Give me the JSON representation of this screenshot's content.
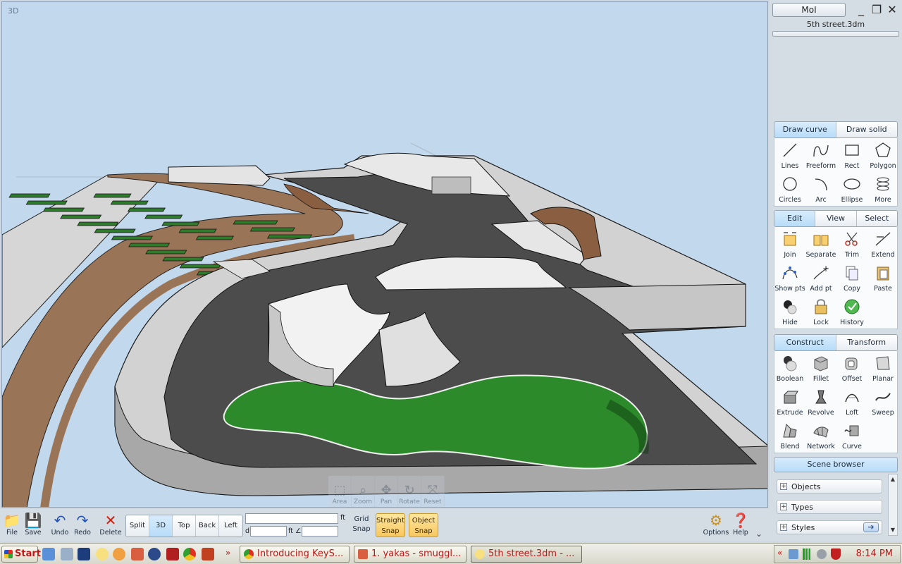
{
  "viewport": {
    "label": "3D",
    "nav_tools": [
      {
        "label": "Area",
        "icon": "area-zoom-icon"
      },
      {
        "label": "Zoom",
        "icon": "zoom-icon"
      },
      {
        "label": "Pan",
        "icon": "pan-icon"
      },
      {
        "label": "Rotate",
        "icon": "rotate-icon"
      },
      {
        "label": "Reset",
        "icon": "reset-icon"
      }
    ]
  },
  "header": {
    "app_button": "MoI",
    "file_name": "5th street.3dm"
  },
  "draw_tabs": [
    "Draw curve",
    "Draw solid"
  ],
  "draw_tools": [
    "Lines",
    "Freeform",
    "Rect",
    "Polygon",
    "Circles",
    "Arc",
    "Ellipse",
    "More"
  ],
  "edit_tabs": [
    "Edit",
    "View",
    "Select"
  ],
  "edit_tools": [
    "Join",
    "Separate",
    "Trim",
    "Extend",
    "Show pts",
    "Add pt",
    "Copy",
    "Paste",
    "Hide",
    "Lock",
    "History"
  ],
  "construct_tabs": [
    "Construct",
    "Transform"
  ],
  "construct_tools": [
    "Boolean",
    "Fillet",
    "Offset",
    "Planar",
    "Extrude",
    "Revolve",
    "Loft",
    "Sweep",
    "Blend",
    "Network",
    "Curve"
  ],
  "scene_browser": {
    "title": "Scene browser",
    "items": [
      "Objects",
      "Types",
      "Styles"
    ]
  },
  "bottom": {
    "file": "File",
    "save": "Save",
    "undo": "Undo",
    "redo": "Redo",
    "delete": "Delete",
    "view_tabs": [
      "Split",
      "3D",
      "Top",
      "Back",
      "Left"
    ],
    "unit": "ft",
    "d_label": "d",
    "angle_label": "∠",
    "grid_snap": [
      "Grid",
      "Snap"
    ],
    "straight_snap": [
      "Straight",
      "Snap"
    ],
    "object_snap": [
      "Object",
      "Snap"
    ],
    "options": "Options",
    "help": "Help"
  },
  "taskbar": {
    "start": "Start",
    "tasks": [
      "Introducing KeyS...",
      "1. yakas - smuggl...",
      "5th street.3dm - ..."
    ],
    "clock": "8:14 PM"
  }
}
